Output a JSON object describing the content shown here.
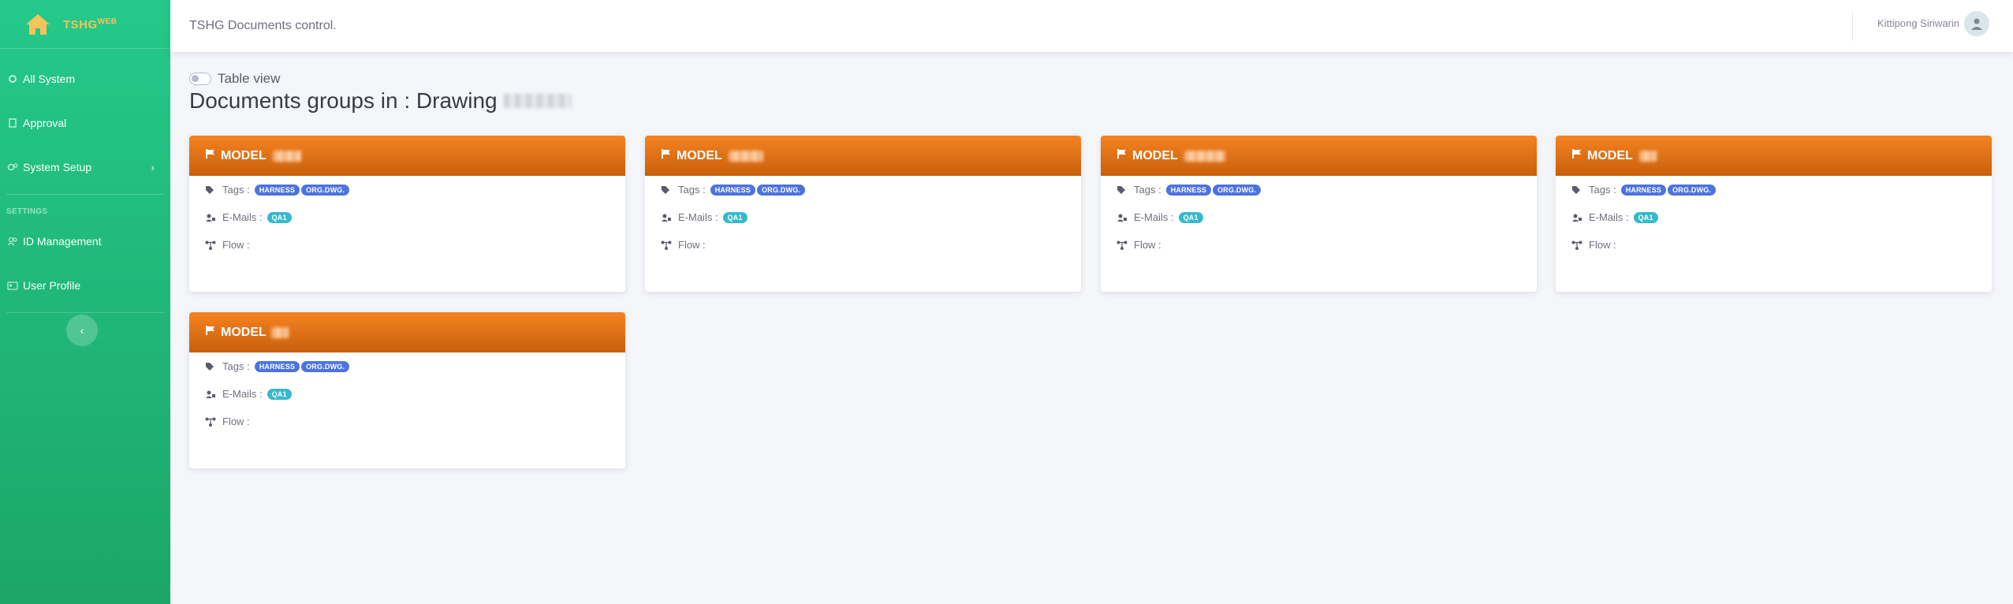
{
  "brand": {
    "name": "TSHG",
    "sup": "WEB"
  },
  "sidebar": {
    "items": [
      {
        "label": "All System",
        "icon": "gear-icon"
      },
      {
        "label": "Approval",
        "icon": "clipboard-icon"
      },
      {
        "label": "System Setup",
        "icon": "gears-icon"
      }
    ],
    "settings_heading": "SETTINGS",
    "settings_items": [
      {
        "label": "ID Management",
        "icon": "users-icon"
      },
      {
        "label": "User Profile",
        "icon": "id-card-icon"
      }
    ]
  },
  "topbar": {
    "title": "TSHG Documents control.",
    "user": "Kittipong Siriwarin"
  },
  "main": {
    "table_view_label": "Table view",
    "heading": "Documents groups in : Drawing"
  },
  "cards": [
    {
      "title": "MODEL",
      "tags_label": "Tags :",
      "tags": [
        "HARNESS",
        "ORG.DWG."
      ],
      "emails_label": "E-Mails :",
      "emails": [
        "QA1"
      ],
      "flow_label": "Flow :"
    },
    {
      "title": "MODEL",
      "tags_label": "Tags :",
      "tags": [
        "HARNESS",
        "ORG.DWG."
      ],
      "emails_label": "E-Mails :",
      "emails": [
        "QA1"
      ],
      "flow_label": "Flow :"
    },
    {
      "title": "MODEL",
      "tags_label": "Tags :",
      "tags": [
        "HARNESS",
        "ORG.DWG."
      ],
      "emails_label": "E-Mails :",
      "emails": [
        "QA1"
      ],
      "flow_label": "Flow :"
    },
    {
      "title": "MODEL",
      "tags_label": "Tags :",
      "tags": [
        "HARNESS",
        "ORG.DWG."
      ],
      "emails_label": "E-Mails :",
      "emails": [
        "QA1"
      ],
      "flow_label": "Flow :"
    },
    {
      "title": "MODEL",
      "tags_label": "Tags :",
      "tags": [
        "HARNESS",
        "ORG.DWG."
      ],
      "emails_label": "E-Mails :",
      "emails": [
        "QA1"
      ],
      "flow_label": "Flow :"
    }
  ],
  "colors": {
    "sidebar_top": "#24c98a",
    "sidebar_bottom": "#1ca667",
    "card_header": "#f58220",
    "tag_badge": "#4e73df",
    "email_badge": "#36b9cc"
  }
}
